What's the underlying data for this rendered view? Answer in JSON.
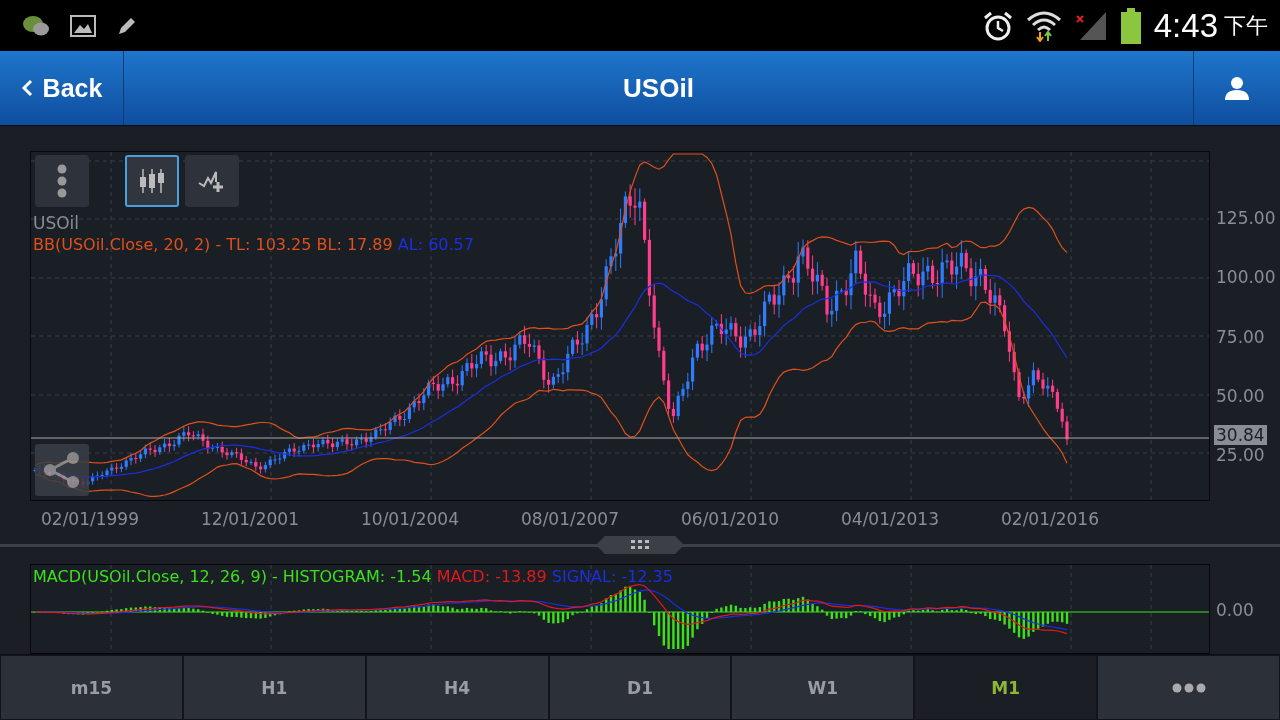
{
  "status_bar": {
    "time": "4:43",
    "period": "下午"
  },
  "header": {
    "back": "Back",
    "title": "USOil"
  },
  "chart_tools": [
    {
      "kind": "menu",
      "selected": false
    },
    {
      "kind": "candles",
      "selected": true
    },
    {
      "kind": "add-indicator",
      "selected": false
    }
  ],
  "main_chart": {
    "symbol": "USOil",
    "bands_text": "BB(USOil.Close, 20, 2) - TL: 103.25 BL: 17.89",
    "average_text": "AL: 60.57",
    "y_labels": [
      "125.00",
      "100.00",
      "75.00",
      "50.00",
      "25.00"
    ],
    "price_tag": "30.84",
    "x_labels": [
      "02/01/1999",
      "12/01/2001",
      "10/01/2004",
      "08/01/2007",
      "06/01/2010",
      "04/01/2013",
      "02/01/2016"
    ]
  },
  "macd_panel": {
    "histogram_text": "MACD(USOil.Close, 12, 26, 9) - HISTOGRAM: -1.54",
    "macd_text": "MACD: -13.89",
    "signal_text": "SIGNAL: -12.35",
    "y_label": "0.00"
  },
  "timeframes": [
    {
      "label": "m15",
      "selected": false
    },
    {
      "label": "H1",
      "selected": false
    },
    {
      "label": "H4",
      "selected": false
    },
    {
      "label": "D1",
      "selected": false
    },
    {
      "label": "W1",
      "selected": false
    },
    {
      "label": "M1",
      "selected": true
    }
  ]
}
